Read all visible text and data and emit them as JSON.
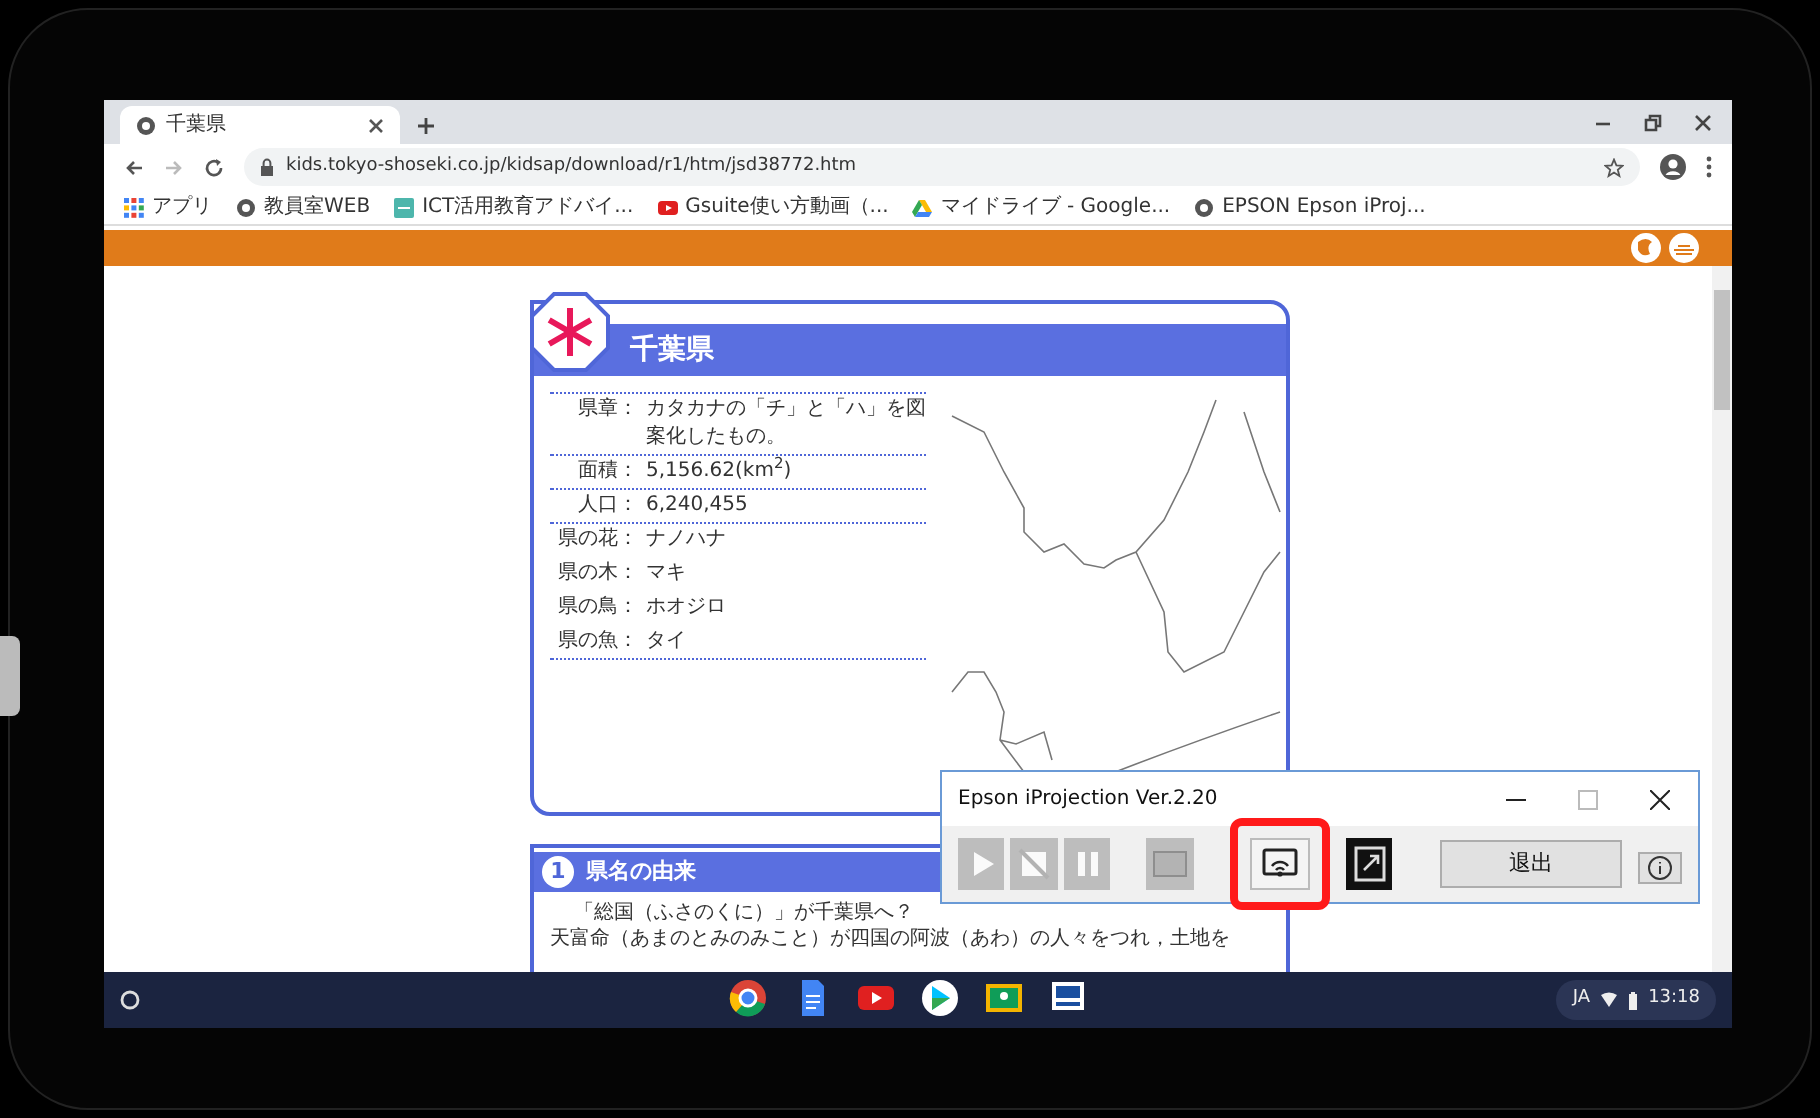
{
  "browser": {
    "tab": {
      "title": "千葉県"
    },
    "url": "kids.tokyo-shoseki.co.jp/kidsap/download/r1/htm/jsd38772.htm",
    "bookmarks": [
      {
        "kind": "apps",
        "label": "アプリ"
      },
      {
        "kind": "globe",
        "label": "教員室WEB"
      },
      {
        "kind": "sheet",
        "label": "ICT活用教育アドバイ..."
      },
      {
        "kind": "video",
        "label": "Gsuite使い方動画（..."
      },
      {
        "kind": "drive",
        "label": "マイドライブ - Google..."
      },
      {
        "kind": "globe",
        "label": "EPSON Epson iProj..."
      }
    ]
  },
  "page": {
    "prefecture": {
      "name": "千葉県",
      "facts": [
        {
          "label": "県章：",
          "value": "カタカナの「チ」と「ハ」を図案化したもの。",
          "divider": true
        },
        {
          "label": "面積：",
          "value": "5,156.62(km$^{2}$)",
          "divider": true
        },
        {
          "label": "人口：",
          "value": "6,240,455",
          "divider": true
        },
        {
          "label": "県の花：",
          "value": "ナノハナ",
          "divider": false
        },
        {
          "label": "県の木：",
          "value": "マキ",
          "divider": false
        },
        {
          "label": "県の鳥：",
          "value": "ホオジロ",
          "divider": false
        },
        {
          "label": "県の魚：",
          "value": "タイ",
          "divider": true
        }
      ]
    },
    "section": {
      "number": "1",
      "title": "県名の由来",
      "lines": [
        "「総国（ふさのくに）」が千葉県へ？",
        "天富命（あまのとみのみこと）が四国の阿波（あわ）の人々をつれ，土地を"
      ]
    }
  },
  "iprojection": {
    "title": "Epson iProjection Ver.2.20",
    "tools": [
      {
        "kind": "play",
        "disabled": true,
        "annotated": false
      },
      {
        "kind": "stop",
        "disabled": true,
        "annotated": false
      },
      {
        "kind": "pause",
        "disabled": true,
        "annotated": false
      },
      {
        "kind": "screen",
        "disabled": true,
        "annotated": false
      },
      {
        "kind": "cast",
        "disabled": false,
        "annotated": true
      },
      {
        "kind": "mirror",
        "disabled": false,
        "annotated": false
      }
    ],
    "exit_label": "退出"
  },
  "taskbar": {
    "apps": [
      {
        "kind": "chrome"
      },
      {
        "kind": "docs"
      },
      {
        "kind": "youtube"
      },
      {
        "kind": "play"
      },
      {
        "kind": "classroom"
      },
      {
        "kind": "projector"
      }
    ],
    "ime": "JA",
    "time": "13:18"
  }
}
